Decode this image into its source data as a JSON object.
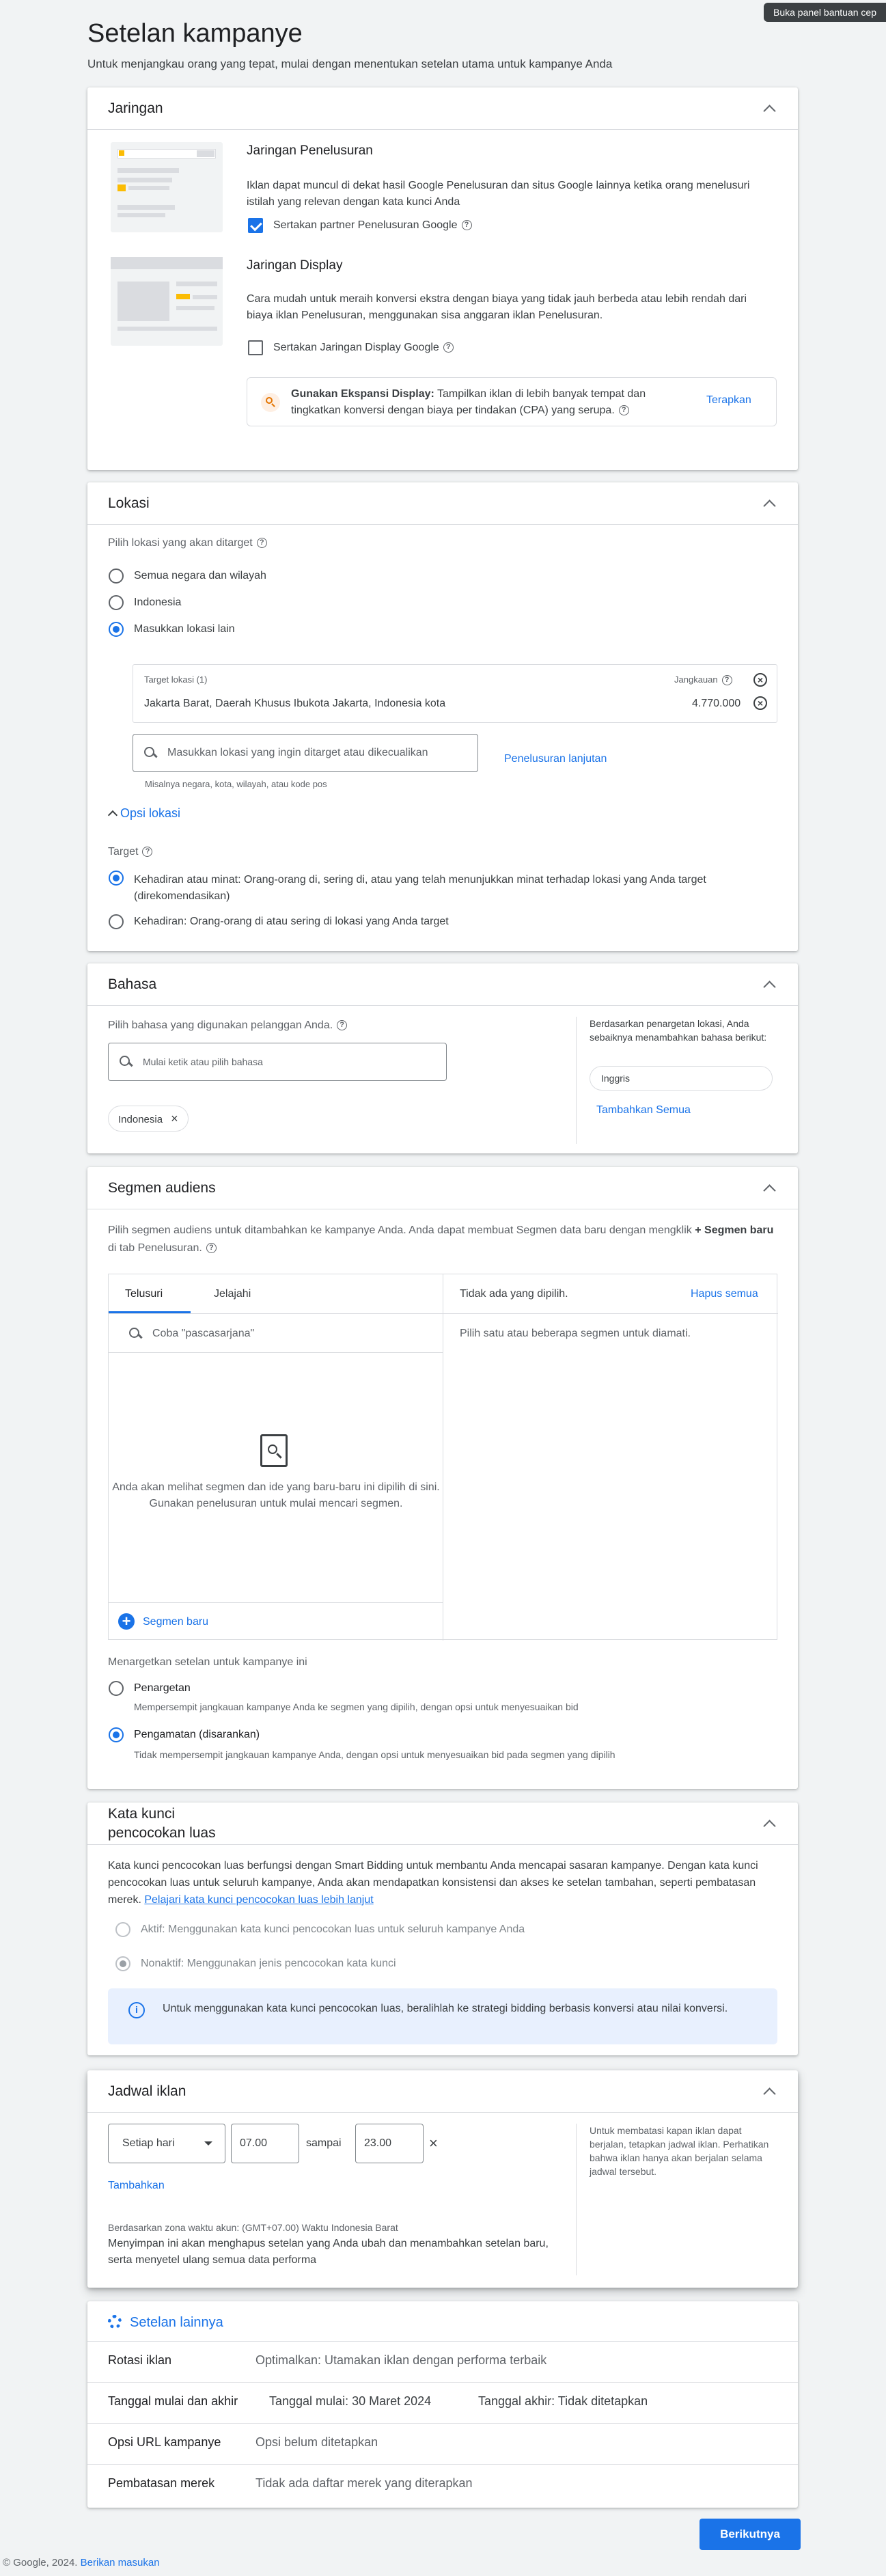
{
  "help_panel_label": "Buka panel bantuan cep",
  "page": {
    "title": "Setelan kampanye",
    "subtitle": "Untuk menjangkau orang yang tepat, mulai dengan menentukan setelan utama untuk kampanye Anda"
  },
  "networks": {
    "title": "Jaringan",
    "search_title": "Jaringan Penelusuran",
    "search_desc": "Iklan dapat muncul di dekat hasil Google Penelusuran dan situs Google lainnya ketika orang menelusuri istilah yang relevan dengan kata kunci Anda",
    "search_partner_label": "Sertakan partner Penelusuran Google",
    "display_title": "Jaringan Display",
    "display_desc": "Cara mudah untuk meraih konversi ekstra dengan biaya yang tidak jauh berbeda atau lebih rendah dari biaya iklan Penelusuran, menggunakan sisa anggaran iklan Penelusuran.",
    "display_include_label": "Sertakan Jaringan Display Google",
    "expansion_bold": "Gunakan Ekspansi Display:",
    "expansion_text": "Tampilkan iklan di lebih banyak tempat dan tingkatkan konversi dengan biaya per tindakan (CPA) yang serupa.",
    "apply_label": "Terapkan"
  },
  "locations": {
    "title": "Lokasi",
    "prompt": "Pilih lokasi yang akan ditarget",
    "options": [
      "Semua negara dan wilayah",
      "Indonesia",
      "Masukkan lokasi lain"
    ],
    "target_header": "Target lokasi (1)",
    "reach_header": "Jangkauan",
    "target_name": "Jakarta Barat, Daerah Khusus Ibukota Jakarta, Indonesia kota",
    "target_reach": "4.770.000",
    "search_placeholder": "Masukkan lokasi yang ingin ditarget atau dikecualikan",
    "advanced_search": "Penelusuran lanjutan",
    "hint": "Misalnya negara, kota, wilayah, atau kode pos",
    "options_toggle": "Opsi lokasi",
    "target_label": "Target",
    "presence_interest": "Kehadiran atau minat: Orang-orang di, sering di, atau yang telah menunjukkan minat terhadap lokasi yang Anda target (direkomendasikan)",
    "presence": "Kehadiran: Orang-orang di atau sering di lokasi yang Anda target"
  },
  "languages": {
    "title": "Bahasa",
    "prompt": "Pilih bahasa yang digunakan pelanggan Anda.",
    "search_placeholder": "Mulai ketik atau pilih bahasa",
    "selected_chip": "Indonesia",
    "suggest_text": "Berdasarkan penargetan lokasi, Anda sebaiknya menambahkan bahasa berikut:",
    "suggest_chip": "Inggris",
    "add_all": "Tambahkan Semua"
  },
  "audiences": {
    "title": "Segmen audiens",
    "desc_part1": "Pilih segmen audiens untuk ditambahkan ke kampanye Anda. Anda dapat membuat Segmen data baru dengan mengklik",
    "desc_bold": "+ Segmen baru",
    "desc_part2": "di tab Penelusuran.",
    "tab_search": "Telusuri",
    "tab_browse": "Jelajahi",
    "search_placeholder": "Coba \"pascasarjana\"",
    "empty_line1": "Anda akan melihat segmen dan ide yang baru-baru ini dipilih di sini.",
    "empty_line2": "Gunakan penelusuran untuk mulai mencari segmen.",
    "new_segment": "Segmen baru",
    "none_selected": "Tidak ada yang dipilih.",
    "clear_all": "Hapus semua",
    "pick_hint": "Pilih satu atau beberapa segmen untuk diamati.",
    "targeting_label": "Menargetkan setelan untuk kampanye ini",
    "targeting_title": "Penargetan",
    "targeting_desc": "Mempersempit jangkauan kampanye Anda ke segmen yang dipilih, dengan opsi untuk menyesuaikan bid",
    "observation_title": "Pengamatan (disarankan)",
    "observation_desc": "Tidak mempersempit jangkauan kampanye Anda, dengan opsi untuk menyesuaikan bid pada segmen yang dipilih"
  },
  "broad_match": {
    "title_line1": "Kata kunci",
    "title_line2": "pencocokan luas",
    "desc": "Kata kunci pencocokan luas berfungsi dengan Smart Bidding untuk membantu Anda mencapai sasaran kampanye. Dengan kata kunci pencocokan luas untuk seluruh kampanye, Anda akan mendapatkan konsistensi dan akses ke setelan tambahan, seperti pembatasan merek.",
    "learn_more": "Pelajari kata kunci pencocokan luas lebih lanjut",
    "active": "Aktif: Menggunakan kata kunci pencocokan luas untuk seluruh kampanye Anda",
    "inactive": "Nonaktif: Menggunakan jenis pencocokan kata kunci",
    "info": "Untuk menggunakan kata kunci pencocokan luas, beralihlah ke strategi bidding berbasis konversi atau nilai konversi."
  },
  "schedule": {
    "title": "Jadwal iklan",
    "day": "Setiap hari",
    "start": "07.00",
    "to": "sampai",
    "end": "23.00",
    "add": "Tambahkan",
    "tz_note": "Berdasarkan zona waktu akun: (GMT+07.00) Waktu Indonesia Barat",
    "warning": "Menyimpan ini akan menghapus setelan yang Anda ubah dan menambahkan setelan baru, serta menyetel ulang semua data performa",
    "side_note": "Untuk membatasi kapan iklan dapat berjalan, tetapkan jadwal iklan. Perhatikan bahwa iklan hanya akan berjalan selama jadwal tersebut."
  },
  "more_settings": {
    "title": "Setelan lainnya",
    "rows": [
      {
        "label": "Rotasi iklan",
        "value": "Optimalkan: Utamakan iklan dengan performa terbaik"
      },
      {
        "label": "Tanggal mulai dan akhir",
        "value": "Tanggal mulai: 30 Maret 2024",
        "value2": "Tanggal akhir: Tidak ditetapkan"
      },
      {
        "label": "Opsi URL kampanye",
        "value": "Opsi belum ditetapkan"
      },
      {
        "label": "Pembatasan merek",
        "value": "Tidak ada daftar merek yang diterapkan"
      }
    ]
  },
  "next_label": "Berikutnya",
  "footer": {
    "copyright": "© Google, 2024.",
    "feedback": "Berikan masukan"
  },
  "colors": {
    "accent": "#1a73e8",
    "background": "#f1f3f4",
    "info_bg": "#e8f0fe"
  }
}
